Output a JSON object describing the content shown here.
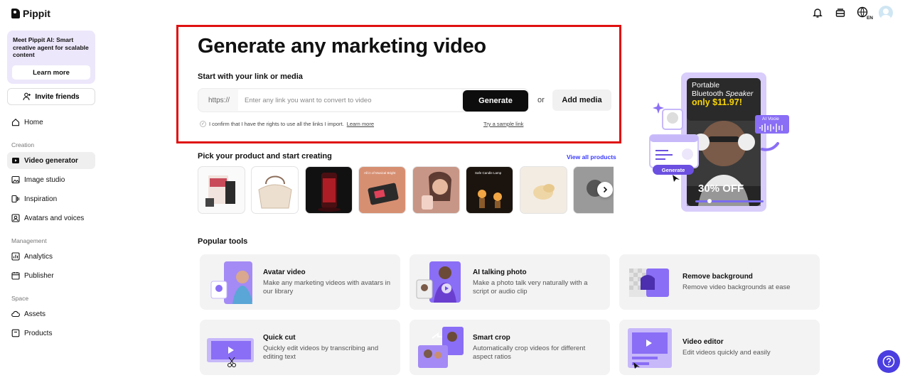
{
  "brand": {
    "name": "Pippit"
  },
  "promo": {
    "text": "Meet Pippit AI: Smart creative agent for scalable content",
    "button": "Learn more"
  },
  "invite": {
    "label": "Invite friends"
  },
  "nav": {
    "home": "Home",
    "section_creation": "Creation",
    "video_generator": "Video generator",
    "image_studio": "Image studio",
    "inspiration": "Inspiration",
    "avatars": "Avatars and voices",
    "section_management": "Management",
    "analytics": "Analytics",
    "publisher": "Publisher",
    "section_space": "Space",
    "assets": "Assets",
    "products": "Products"
  },
  "header": {
    "language": "EN"
  },
  "hero": {
    "title": "Generate any marketing video",
    "subtitle": "Start with your link or media",
    "url_prefix": "https://",
    "placeholder": "Enter any link you want to convert to video",
    "generate": "Generate",
    "or": "or",
    "add_media": "Add media",
    "confirm_text": "I confirm that I have the rights to use all the links I import.",
    "confirm_link": "Learn more",
    "sample_link": "Try a sample link"
  },
  "illustration": {
    "product_line1": "Portable",
    "product_line2": "Bluetooth",
    "product_line2_italic": "Speaker",
    "price": "only $11.97!",
    "ai_voice": "AI Vocie",
    "generate": "Generate",
    "discount": "30% OFF"
  },
  "products": {
    "title": "Pick your product and start creating",
    "view_all": "View all products",
    "thumb_labels": {
      "keyboard": "All in of Musical Bright",
      "lamp": "Safe Candle Lamp"
    }
  },
  "tools": {
    "title": "Popular tools",
    "items": [
      {
        "name": "Avatar video",
        "desc": "Make any marketing videos with avatars in our library"
      },
      {
        "name": "AI talking photo",
        "desc": "Make a photo talk very naturally with a script or audio clip"
      },
      {
        "name": "Remove background",
        "desc": "Remove video backgrounds at ease"
      },
      {
        "name": "Quick cut",
        "desc": "Quickly edit videos by transcribing and editing text"
      },
      {
        "name": "Smart crop",
        "desc": "Automatically crop videos for different aspect ratios"
      },
      {
        "name": "Video editor",
        "desc": "Edit videos quickly and easily"
      }
    ]
  },
  "colors": {
    "accent": "#6b4fe0",
    "primary_button": "#0d0d0d",
    "highlight_border": "#e01010",
    "link": "#3a3aff"
  }
}
